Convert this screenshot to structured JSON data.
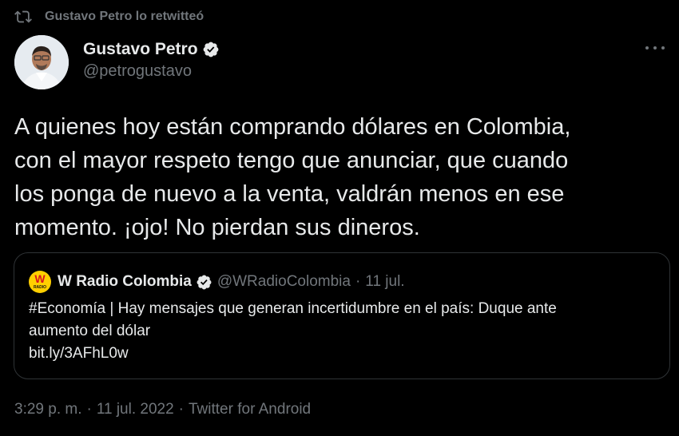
{
  "retweet_banner": {
    "text": "Gustavo Petro lo retwitteó",
    "icon": "retweet-icon"
  },
  "author": {
    "name": "Gustavo Petro",
    "handle": "@petrogustavo",
    "verified_icon": "verified-badge-icon",
    "avatar_icon": "profile-photo"
  },
  "more_menu": {
    "icon": "more-options-icon"
  },
  "tweet": {
    "lines": [
      "A quienes hoy están comprando dólares en Colombia,",
      "con el mayor respeto tengo que anunciar, que cuando",
      "los ponga de nuevo a la venta, valdrán menos en ese",
      "momento. ¡ojo! No pierdan sus dineros."
    ]
  },
  "quoted_tweet": {
    "logo_text": "W",
    "logo_subtext": "RADIO",
    "name": "W Radio Colombia",
    "handle": "@WRadioColombia",
    "separator": "·",
    "date": "11 jul.",
    "lines": [
      "#Economía | Hay mensajes que generan incertidumbre en el país: Duque ante",
      "aumento del dólar",
      "bit.ly/3AFhL0w"
    ]
  },
  "meta": {
    "time": "3:29 p. m.",
    "separator": "·",
    "date": "11 jul. 2022",
    "source": "Twitter for Android"
  },
  "colors": {
    "background": "#000000",
    "text": "#e7e9ea",
    "muted": "#71767b",
    "border": "#2f3336",
    "verified": "#1d9bf0",
    "w_logo_bg": "#ffcf00"
  }
}
